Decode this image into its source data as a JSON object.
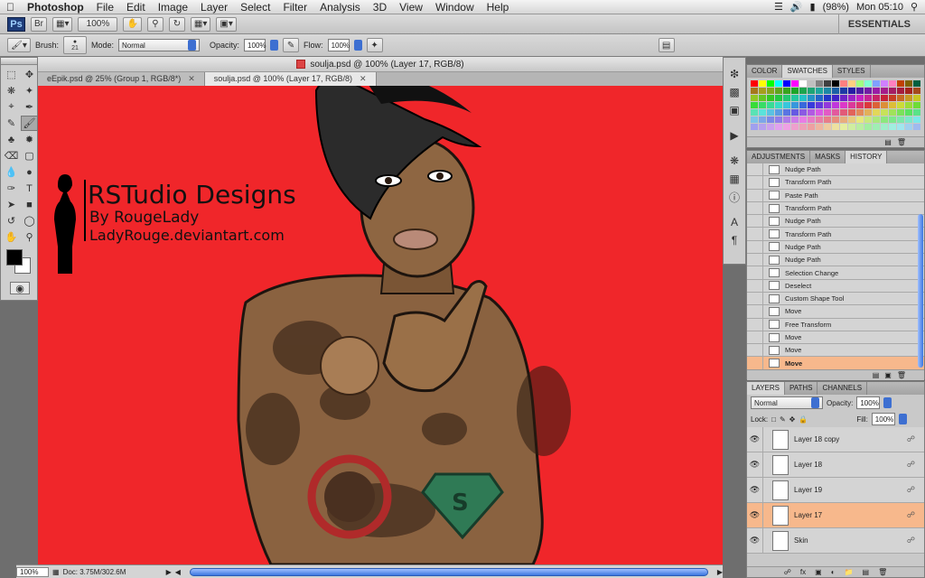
{
  "menubar": {
    "app_name": "Photoshop",
    "items": [
      "File",
      "Edit",
      "Image",
      "Layer",
      "Select",
      "Filter",
      "Analysis",
      "3D",
      "View",
      "Window",
      "Help"
    ],
    "battery": "(98%)",
    "clock": "Mon 05:10"
  },
  "appbar": {
    "ps_badge": "Ps",
    "br_badge": "Br",
    "zoom": "100%",
    "workspace": "ESSENTIALS"
  },
  "options": {
    "brush_label": "Brush:",
    "brush_size": "21",
    "mode_label": "Mode:",
    "mode_value": "Normal",
    "opacity_label": "Opacity:",
    "opacity_value": "100%",
    "flow_label": "Flow:",
    "flow_value": "100%"
  },
  "document": {
    "title": "soulja.psd @ 100% (Layer 17, RGB/8)",
    "tabs": [
      {
        "label": "eEpik.psd @ 25% (Group 1, RGB/8*)"
      },
      {
        "label": "soulja.psd @ 100% (Layer 17, RGB/8)"
      }
    ],
    "zoom": "100%",
    "doc_size": "Doc: 3.75M/302.6M"
  },
  "artwork": {
    "watermark_line1": "RSTudio Designs",
    "watermark_line2": "By RougeLady",
    "watermark_line3": "LadyRouge.deviantart.com",
    "background_color": "#f0262a"
  },
  "swatches_panel": {
    "tabs": [
      "COLOR",
      "SWATCHES",
      "STYLES"
    ],
    "active_tab": "SWATCHES"
  },
  "history_panel": {
    "tabs": [
      "ADJUSTMENTS",
      "MASKS",
      "HISTORY"
    ],
    "active_tab": "HISTORY",
    "items": [
      "Nudge Path",
      "Transform Path",
      "Paste Path",
      "Transform Path",
      "Nudge Path",
      "Transform Path",
      "Nudge Path",
      "Nudge Path",
      "Selection Change",
      "Deselect",
      "Custom Shape Tool",
      "Move",
      "Free Transform",
      "Move",
      "Move",
      "Move"
    ],
    "selected_index": 15
  },
  "layers_panel": {
    "tabs": [
      "LAYERS",
      "PATHS",
      "CHANNELS"
    ],
    "active_tab": "LAYERS",
    "blend_mode": "Normal",
    "opacity_label": "Opacity:",
    "opacity_value": "100%",
    "lock_label": "Lock:",
    "fill_label": "Fill:",
    "fill_value": "100%",
    "layers": [
      {
        "name": "Layer 18 copy"
      },
      {
        "name": "Layer 18"
      },
      {
        "name": "Layer 19"
      },
      {
        "name": "Layer 17"
      },
      {
        "name": "Skin"
      }
    ],
    "selected_index": 3
  },
  "colors": {
    "accent": "#3c77e0",
    "selection": "#f7b88c",
    "canvas_red": "#f0262a"
  }
}
